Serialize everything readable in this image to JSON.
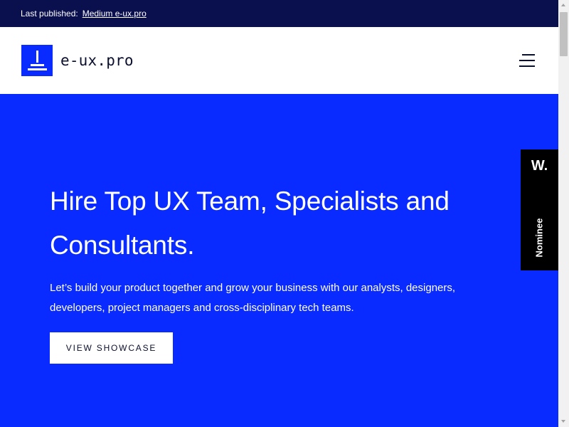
{
  "topbar": {
    "label": "Last published:",
    "link_text": "Medium e-ux.pro"
  },
  "header": {
    "logo_text": "e-ux.pro",
    "menu_icon": "hamburger-menu-icon"
  },
  "hero": {
    "title": "Hire Top UX Team, Specialists and Consultants.",
    "description": "Let’s build your product together and grow your business with our analysts, designers, developers, project managers and cross-disciplinary tech teams.",
    "cta_label": "VIEW SHOWCASE"
  },
  "award": {
    "logo": "W.",
    "label": "Nominee"
  },
  "colors": {
    "topbar_bg": "#0a0f4d",
    "brand_blue": "#0a2bff",
    "award_bg": "#000000",
    "text_dark": "#0a0f2d"
  }
}
